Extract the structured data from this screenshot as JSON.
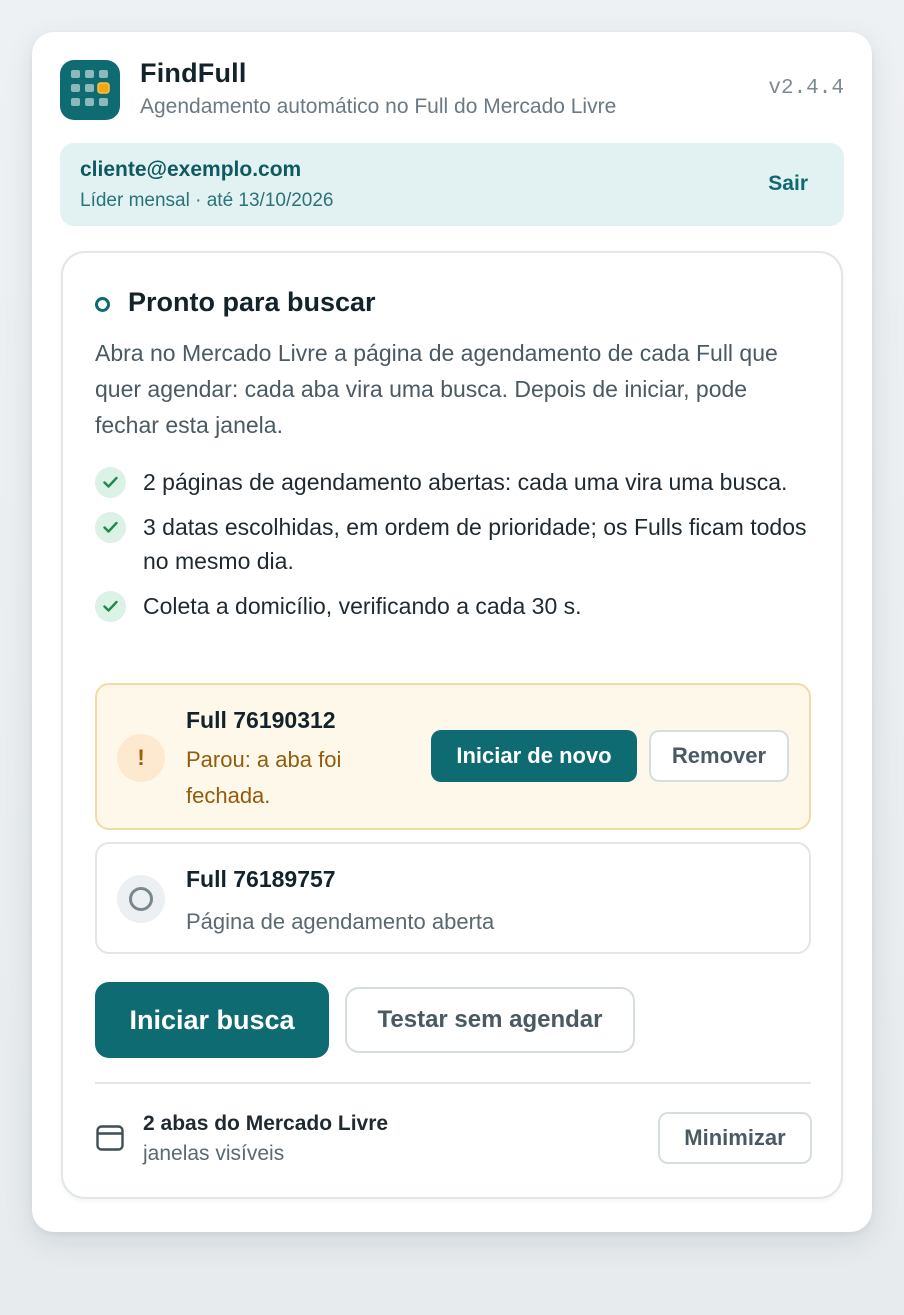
{
  "header": {
    "app_name": "FindFull",
    "subtitle": "Agendamento automático no Full do Mercado Livre",
    "version": "v2.4.4",
    "logo_icon": "calendar-grid-icon"
  },
  "account": {
    "email": "cliente@exemplo.com",
    "plan": "Líder mensal · até 13/10/2026",
    "logout_label": "Sair"
  },
  "status": {
    "title": "Pronto para buscar",
    "description": "Abra no Mercado Livre a página de agendamento de cada Full que quer agendar: cada aba vira uma busca. Depois de iniciar, pode fechar esta janela."
  },
  "checklist": [
    "2 páginas de agendamento abertas: cada uma vira uma busca.",
    "3 datas escolhidas, em ordem de prioridade; os Fulls ficam todos no mesmo dia.",
    "Coleta a domicílio, verificando a cada 30 s."
  ],
  "fulls": [
    {
      "name": "Full 76190312",
      "status": "Parou: a aba foi fechada.",
      "state": "warning",
      "restart_label": "Iniciar de novo",
      "remove_label": "Remover"
    },
    {
      "name": "Full 76189757",
      "status": "Página de agendamento aberta",
      "state": "idle"
    }
  ],
  "actions": {
    "start_label": "Iniciar busca",
    "test_label": "Testar sem agendar"
  },
  "footer": {
    "tabs_title": "2 abas do Mercado Livre",
    "tabs_sub": "janelas visíveis",
    "minimize_label": "Minimizar"
  },
  "colors": {
    "brand": "#0f6b72",
    "warning_bg": "#fef8ea",
    "warning_text": "#925c0c",
    "success_bg": "#dcf2e6",
    "account_bg": "#e2f2f2"
  }
}
